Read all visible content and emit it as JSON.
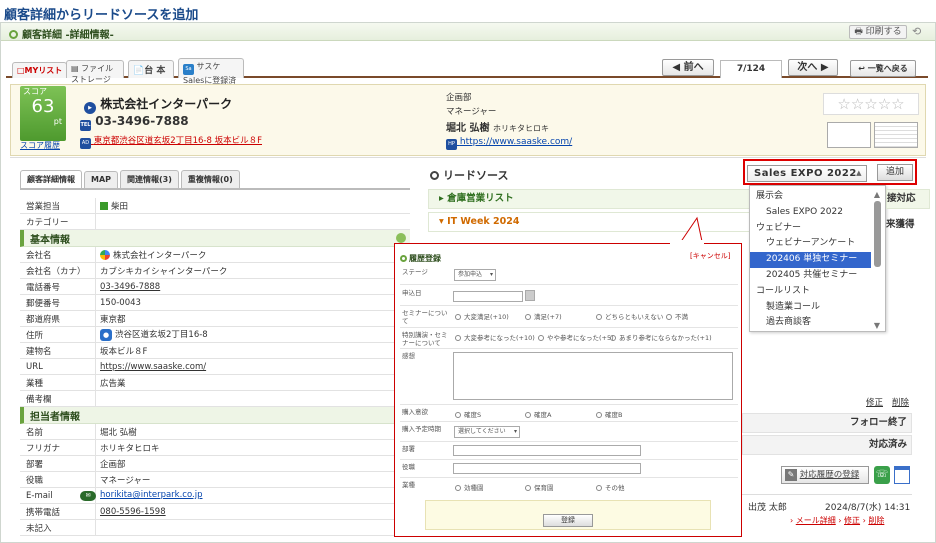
{
  "caption": "顧客詳細からリードソースを追加",
  "window": {
    "title": "顧客詳細 -詳細情報-",
    "print_label": "印刷する"
  },
  "favtabs": [
    "□MYリスト",
    "ファイルストレージ",
    "台 本",
    "サスケSalesに登録済"
  ],
  "nav": {
    "prev": "前へ",
    "pager": "7/124",
    "next": "次へ",
    "back_list": "一覧へ戻る"
  },
  "header": {
    "score_label": "スコア",
    "score_value": "63",
    "score_unit": "pt",
    "score_history": "スコア履歴",
    "company": "株式会社インターパーク",
    "tel_icon": "TEL",
    "tel": "03-3496-7888",
    "addr_icon": "AD",
    "address": "東京都渋谷区道玄坂2丁目16-8 坂本ビル８F",
    "department": "企画部",
    "position": "マネージャー",
    "person_name": "堀北 弘樹",
    "person_kana": "ホリキタヒロキ",
    "hp_icon": "HP",
    "url": "https://www.saaske.com/",
    "stars": "☆☆☆☆☆"
  },
  "left_tabs": [
    "顧客詳細情報",
    "MAP",
    "関連情報(3)",
    "重複情報(0)"
  ],
  "details": {
    "rows_top": [
      {
        "k": "営業担当",
        "v": "柴田"
      },
      {
        "k": "カテゴリー",
        "v": ""
      }
    ],
    "section_basic": "基本情報",
    "rows_basic": [
      {
        "k": "会社名",
        "v": "株式会社インターパーク"
      },
      {
        "k": "会社名（カナ）",
        "v": "カブシキカイシャインターパーク"
      },
      {
        "k": "電話番号",
        "v": "03-3496-7888"
      },
      {
        "k": "郵便番号",
        "v": "150-0043"
      },
      {
        "k": "都道府県",
        "v": "東京都"
      },
      {
        "k": "住所",
        "v": "渋谷区道玄坂2丁目16-8"
      },
      {
        "k": "建物名",
        "v": "坂本ビル８F"
      },
      {
        "k": "URL",
        "v": "https://www.saaske.com/"
      },
      {
        "k": "業種",
        "v": "広告業"
      },
      {
        "k": "備考欄",
        "v": ""
      }
    ],
    "section_contact": "担当者情報",
    "rows_contact": [
      {
        "k": "名前",
        "v": "堀北 弘樹"
      },
      {
        "k": "フリガナ",
        "v": "ホリキタヒロキ"
      },
      {
        "k": "部署",
        "v": "企画部"
      },
      {
        "k": "役職",
        "v": "マネージャー"
      },
      {
        "k": "E-mail",
        "v": "horikita@interpark.co.jp"
      },
      {
        "k": "携帯電話",
        "v": "080-5596-1598"
      },
      {
        "k": "未記入",
        "v": ""
      }
    ]
  },
  "lead": {
    "title": "リードソース",
    "groups": [
      "倉庫営業リスト",
      "IT Week 2024"
    ],
    "select_value": "Sales EXPO 2022",
    "add_label": "追加",
    "dropdown": [
      {
        "label": "展示会",
        "type": "group"
      },
      {
        "label": "Sales EXPO 2022",
        "type": "opt"
      },
      {
        "label": "ウェビナー",
        "type": "group"
      },
      {
        "label": "ウェビナーアンケート",
        "type": "opt"
      },
      {
        "label": "202406 単独セミナー",
        "type": "sel"
      },
      {
        "label": "202405 共催セミナー",
        "type": "opt"
      },
      {
        "label": "コールリスト",
        "type": "group"
      },
      {
        "label": "製造業コール",
        "type": "opt"
      },
      {
        "label": "過去商談客",
        "type": "opt"
      }
    ]
  },
  "right": {
    "r1": "接対応",
    "r2": "来獲得",
    "edit": "修正",
    "del": "削除",
    "follow": "フォロー終了",
    "handled": "対応済み",
    "history_btn": "対応履歴の登録",
    "person": "出茂 太郎",
    "datetime": "2024/8/7(水) 14:31",
    "mail_detail": "メール詳細",
    "edit2": "修正",
    "del2": "削除"
  },
  "popup": {
    "title": "履歴登録",
    "cancel": "[キャンセル]",
    "stage_label": "ステージ",
    "stage_value": "参加申込",
    "date_label": "申込日",
    "seminar_label": "セミナーについて",
    "seminar_opts": [
      "大変満足(+10)",
      "満足(+7)",
      "どちらともいえない",
      "不満"
    ],
    "special_label": "特別講演・セミナーについて",
    "special_opts": [
      "大変参考になった(+10)",
      "やや参考になった(+5)",
      "あまり参考にならなかった(+1)"
    ],
    "impression_label": "感想",
    "intent_label": "購入意欲",
    "intent_opts": [
      "確度S",
      "確度A",
      "確度B"
    ],
    "timing_label": "購入予定時期",
    "timing_value": "選択してください",
    "dept_label": "部署",
    "title_label": "役職",
    "industry_label": "業種",
    "industry_opts": [
      "効種園",
      "保育園",
      "その他"
    ],
    "register": "登録"
  }
}
